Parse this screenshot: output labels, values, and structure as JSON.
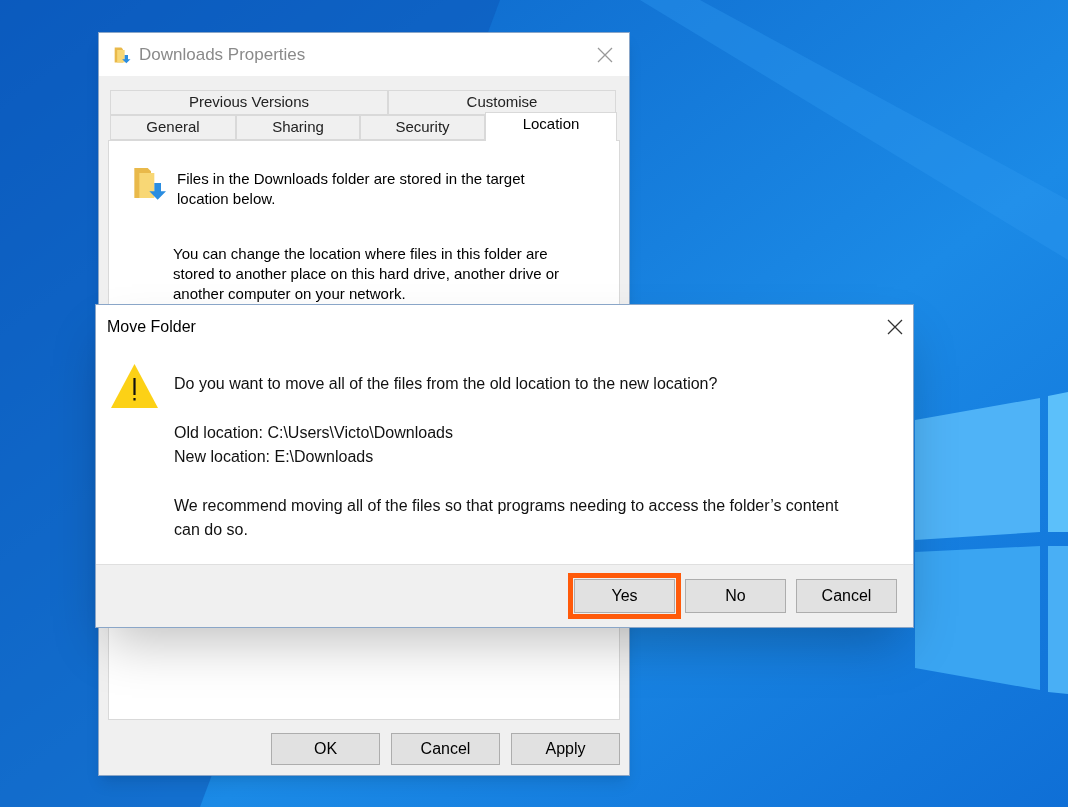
{
  "properties_window": {
    "title": "Downloads Properties",
    "tab_rows": [
      [
        {
          "label": "Previous Versions",
          "selected": false
        },
        {
          "label": "Customise",
          "selected": false
        }
      ],
      [
        {
          "label": "General",
          "selected": false
        },
        {
          "label": "Sharing",
          "selected": false
        },
        {
          "label": "Security",
          "selected": false
        },
        {
          "label": "Location",
          "selected": true
        }
      ]
    ],
    "intro": "Files in the Downloads folder are stored in the target location below.",
    "description": "You can change the location where files in this folder are stored to another place on this hard drive, another drive or another computer on your network.",
    "buttons": [
      "OK",
      "Cancel",
      "Apply"
    ]
  },
  "move_folder_dialog": {
    "title": "Move Folder",
    "question": "Do you want to move all of the files from the old location to the new location?",
    "old_location": "Old location: C:\\Users\\Victo\\Downloads",
    "new_location": "New location: E:\\Downloads",
    "recommendation": "We recommend moving all of the files so that programs needing to access the folder’s content can do so.",
    "buttons": [
      {
        "label": "Yes",
        "highlighted": true
      },
      {
        "label": "No",
        "highlighted": false
      },
      {
        "label": "Cancel",
        "highlighted": false
      }
    ]
  }
}
